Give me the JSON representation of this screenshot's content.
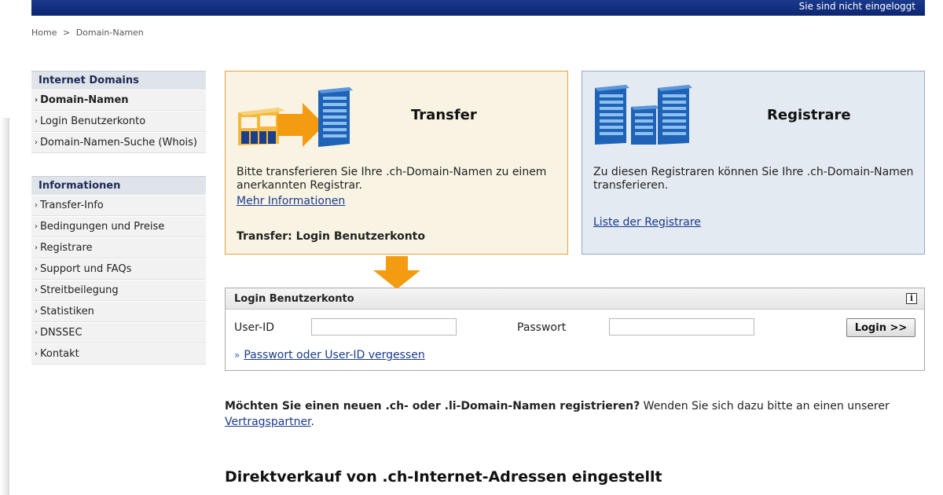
{
  "topbar": {
    "status": "Sie sind nicht eingeloggt"
  },
  "breadcrumb": {
    "home": "Home",
    "sep": ">",
    "current": "Domain-Namen"
  },
  "sidebar": {
    "domains": {
      "heading": "Internet Domains",
      "items": [
        {
          "label": "Domain-Namen",
          "active": true
        },
        {
          "label": "Login Benutzerkonto"
        },
        {
          "label": "Domain-Namen-Suche (Whois)"
        }
      ]
    },
    "info": {
      "heading": "Informationen",
      "items": [
        {
          "label": "Transfer-Info"
        },
        {
          "label": "Bedingungen und Preise"
        },
        {
          "label": "Registrare"
        },
        {
          "label": "Support und FAQs"
        },
        {
          "label": "Streitbeilegung"
        },
        {
          "label": "Statistiken"
        },
        {
          "label": "DNSSEC"
        },
        {
          "label": "Kontakt"
        }
      ]
    },
    "chevron": "›"
  },
  "transfer_card": {
    "title": "Transfer",
    "text": "Bitte transferieren Sie Ihre .ch-Domain-Namen zu einem anerkannten Registrar.",
    "link": "Mehr Informationen",
    "footer": "Transfer: Login Benutzerkonto"
  },
  "registrare_card": {
    "title": "Registrare",
    "text": "Zu diesen Registraren können Sie Ihre .ch-Domain-Namen transferieren.",
    "link": "Liste der Registrare"
  },
  "login": {
    "heading": "Login Benutzerkonto",
    "info_icon": "i",
    "user_label": "User-ID",
    "user_value": "",
    "pass_label": "Passwort",
    "pass_value": "",
    "button": "Login >>",
    "forgot_marker": "»",
    "forgot": "Passwort oder User-ID vergessen"
  },
  "notice": {
    "bold": "Möchten Sie einen neuen .ch- oder .li-Domain-Namen registrieren?",
    "text": " Wenden Sie sich dazu bitte an einen unserer ",
    "link": "Vertragspartner",
    "end": "."
  },
  "direktverkauf": {
    "title": "Direktverkauf von .ch-Internet-Adressen eingestellt"
  },
  "colors": {
    "topbar": "#0c2570",
    "transfer_border": "#e8a33a",
    "arrow": "#f39c12",
    "registrare_bg": "#e4eaf1",
    "link": "#1a3a8c"
  }
}
